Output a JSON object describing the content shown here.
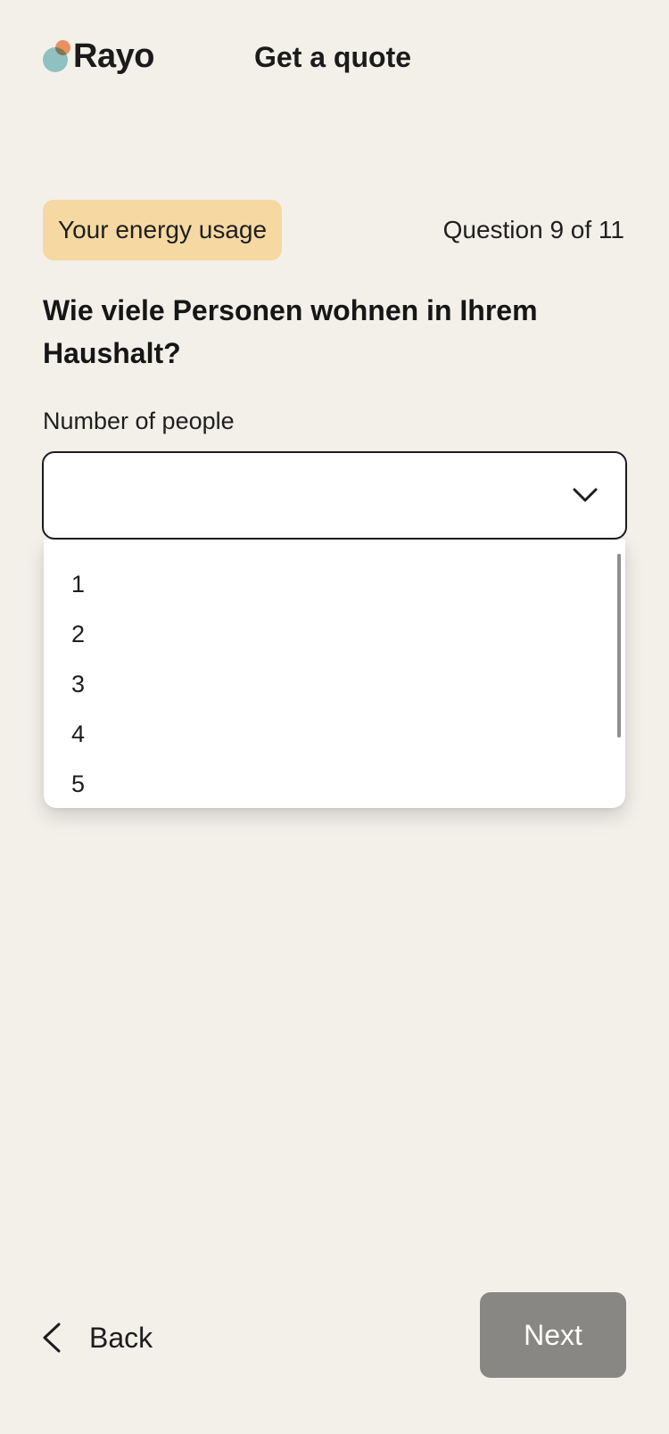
{
  "header": {
    "logo_text": "Rayo",
    "title": "Get a quote"
  },
  "section": {
    "badge": "Your energy usage",
    "counter": "Question 9 of 11"
  },
  "question": {
    "text": "Wie viele Personen wohnen in Ihrem Haushalt?",
    "field_label": "Number of people",
    "selected_value": ""
  },
  "dropdown": {
    "options": [
      "1",
      "2",
      "3",
      "4",
      "5"
    ]
  },
  "footer": {
    "back_label": "Back",
    "next_label": "Next"
  },
  "colors": {
    "background": "#f3f0ea",
    "badge": "#f6d9a2",
    "logo_teal": "#8fc1c0",
    "logo_orange": "#f39a6b",
    "next_button": "#888784"
  },
  "icons": {
    "select": "chevron-down-icon",
    "back": "chevron-left-icon"
  }
}
